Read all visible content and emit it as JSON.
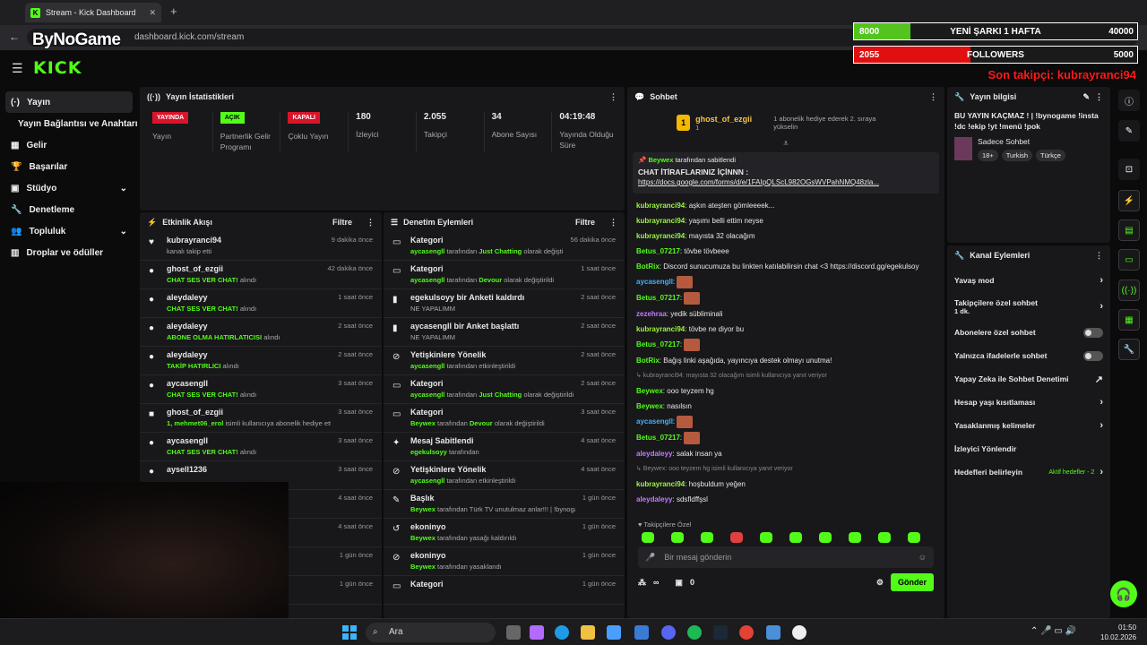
{
  "browser": {
    "tab_title": "Stream - Kick Dashboard",
    "url": "dashboard.kick.com/stream",
    "overlay_brand": "ByNoGame"
  },
  "overlay": {
    "song_left": "8000",
    "song_title": "YENİ ŞARKI 1 HAFTA",
    "song_right": "40000",
    "song_progress": 0.2,
    "fol_left": "2055",
    "fol_title": "FOLLOWERS",
    "fol_right": "5000",
    "fol_progress": 0.41,
    "last_follow": "Son takipçi: kubrayranci94"
  },
  "header": {
    "logo": "KICK"
  },
  "sidebar": [
    {
      "label": "Yayın",
      "active": true
    },
    {
      "label": "Yayın Bağlantısı ve Anahtarı"
    },
    {
      "label": "Gelir"
    },
    {
      "label": "Başarılar"
    },
    {
      "label": "Stüdyo",
      "chev": true
    },
    {
      "label": "Denetleme"
    },
    {
      "label": "Topluluk",
      "chev": true
    },
    {
      "label": "Droplar ve ödüller"
    }
  ],
  "stats": {
    "title": "Yayın İstatistikleri",
    "items": [
      {
        "badge": "YAYINDA",
        "badge_color": "red",
        "label": "Yayın"
      },
      {
        "badge": "AÇIK",
        "badge_color": "green",
        "label": "Partnerlik Gelir Programı"
      },
      {
        "badge": "KAPALI",
        "badge_color": "red",
        "label": "Çoklu Yayın"
      },
      {
        "num": "180",
        "label": "İzleyici"
      },
      {
        "num": "2.055",
        "label": "Takipçi"
      },
      {
        "num": "34",
        "label": "Abone Sayısı"
      },
      {
        "num": "04:19:48",
        "label": "Yayında Olduğu Süre"
      }
    ]
  },
  "activity": {
    "title": "Etkinlik Akışı",
    "filter": "Filtre",
    "rows": [
      {
        "icon": "♥",
        "user": "kubrayranci94",
        "detail": "kanalı takip etti",
        "hl": "",
        "time": "9 dakika önce"
      },
      {
        "icon": "●",
        "user": "ghost_of_ezgii",
        "hl": "CHAT SES VER CHAT!",
        "detail": " alındı",
        "time": "42 dakika önce"
      },
      {
        "icon": "●",
        "user": "aleydaleyy",
        "hl": "CHAT SES VER CHAT!",
        "detail": " alındı",
        "time": "1 saat önce"
      },
      {
        "icon": "●",
        "user": "aleydaleyy",
        "hl": "ABONE OLMA HATIRLATICISI",
        "detail": " alındı",
        "time": "2 saat önce"
      },
      {
        "icon": "●",
        "user": "aleydaleyy",
        "hl": "TAKİP HATIRLICI",
        "detail": " alındı",
        "time": "2 saat önce"
      },
      {
        "icon": "●",
        "user": "aycasengll",
        "hl": "CHAT SES VER CHAT!",
        "detail": " alındı",
        "time": "3 saat önce"
      },
      {
        "icon": "■",
        "user": "ghost_of_ezgii",
        "hl": "1, mehmet06_erol",
        "detail": " isimli kullanıcıya abonelik hediye etti.",
        "time": "3 saat önce"
      },
      {
        "icon": "●",
        "user": "aycasengll",
        "hl": "CHAT SES VER CHAT!",
        "detail": " alındı",
        "time": "3 saat önce"
      },
      {
        "icon": "●",
        "user": "aysell1236",
        "hl": "",
        "detail": "",
        "time": "3 saat önce"
      },
      {
        "icon": "",
        "user": "",
        "hl": "",
        "detail": "",
        "time": "4 saat önce"
      },
      {
        "icon": "",
        "user": "",
        "hl": "",
        "detail": "",
        "time": "4 saat önce"
      },
      {
        "icon": "",
        "user": "",
        "hl": "",
        "detail": "",
        "time": "1 gün önce"
      },
      {
        "icon": "",
        "user": "",
        "hl": "",
        "detail": "",
        "time": "1 gün önce"
      }
    ]
  },
  "moderation": {
    "title": "Denetim Eylemleri",
    "filter": "Filtre",
    "rows": [
      {
        "icon": "▭",
        "title": "Kategori",
        "hl": "aycasengll",
        "detail": " tarafından ",
        "hl2": "Just Chatting",
        "detail2": " olarak değiştirildi",
        "time": "56 dakika önce"
      },
      {
        "icon": "▭",
        "title": "Kategori",
        "hl": "aycasengll",
        "detail": " tarafından ",
        "hl2": "Devour",
        "detail2": " olarak değiştirildi",
        "time": "1 saat önce"
      },
      {
        "icon": "▮",
        "title": "egekulsoyy bir Anketi kaldırdı",
        "hl": "",
        "detail": "NE YAPALIMM",
        "hl2": "",
        "detail2": "",
        "time": "2 saat önce"
      },
      {
        "icon": "▮",
        "title": "aycasengll bir Anket başlattı",
        "hl": "",
        "detail": "NE YAPALIMM",
        "hl2": "",
        "detail2": "",
        "time": "2 saat önce"
      },
      {
        "icon": "⊘",
        "title": "Yetişkinlere Yönelik",
        "hl": "aycasengll",
        "detail": " tarafından etkinleştirildi",
        "hl2": "",
        "detail2": "",
        "time": "2 saat önce"
      },
      {
        "icon": "▭",
        "title": "Kategori",
        "hl": "aycasengll",
        "detail": " tarafından ",
        "hl2": "Just Chatting",
        "detail2": " olarak değiştirildi",
        "time": "2 saat önce"
      },
      {
        "icon": "▭",
        "title": "Kategori",
        "hl": "Beywex",
        "detail": " tarafından ",
        "hl2": "Devour",
        "detail2": " olarak değiştirildi",
        "time": "3 saat önce"
      },
      {
        "icon": "✦",
        "title": "Mesaj Sabitlendi",
        "hl": "egekulsoyy",
        "detail": " tarafından",
        "hl2": "",
        "detail2": "",
        "time": "4 saat önce"
      },
      {
        "icon": "⊘",
        "title": "Yetişkinlere Yönelik",
        "hl": "aycasengll",
        "detail": " tarafından etkinleştirildi",
        "hl2": "",
        "detail2": "",
        "time": "4 saat önce"
      },
      {
        "icon": "✎",
        "title": "Başlık",
        "hl": "Beywex",
        "detail": " tarafından Türk TV unutulmaz anlar!!! | !bynogame !insta !dc !ekip !yt !menü !pok",
        "hl2": "",
        "detail2": "",
        "time": "1 gün önce"
      },
      {
        "icon": "↺",
        "title": "ekoninyo",
        "hl": "Beywex",
        "detail": " tarafından yasağı kaldırıldı",
        "hl2": "",
        "detail2": "",
        "time": "1 gün önce"
      },
      {
        "icon": "⊘",
        "title": "ekoninyo",
        "hl": "Beywex",
        "detail": " tarafından yasaklandı",
        "hl2": "",
        "detail2": "",
        "time": "1 gün önce"
      },
      {
        "icon": "▭",
        "title": "Kategori",
        "hl": "",
        "detail": "",
        "hl2": "",
        "detail2": "",
        "time": "1 gün önce"
      }
    ]
  },
  "chat": {
    "title": "Sohbet",
    "top_user": "ghost_of_ezgii",
    "top_count": "1",
    "top_note": "1 abonelik hediye ederek 2. sıraya yükselin",
    "pin_by": "Beywex",
    "pin_suffix": " tarafından sabitlendi",
    "pin_text": "CHAT İTİRAFLARINIZ İÇİNNN :",
    "pin_link": "https://docs.google.com/forms/d/e/1FAIpQLScL982OGsWVPahNMQ48zla...",
    "messages": [
      {
        "u": "kubrayranci94",
        "c": "lime",
        "t": "aşkın ateşten gömleeeek..."
      },
      {
        "u": "kubrayranci94",
        "c": "lime",
        "t": "yaşımı belli ettim neyse"
      },
      {
        "u": "kubrayranci94",
        "c": "lime",
        "t": "mayısta 32 olacağım"
      },
      {
        "u": "Betus_07217",
        "c": "pink",
        "t": "tövbe tövbeee"
      },
      {
        "u": "BotRix",
        "c": "pink",
        "t": "Discord sunucumuza bu linkten katılabilirsin chat <3 https://discord.gg/egekulsoy"
      },
      {
        "u": "aycasengll",
        "c": "blue",
        "t": "",
        "emo": true
      },
      {
        "u": "Betus_07217",
        "c": "pink",
        "t": "",
        "emo": true
      },
      {
        "u": "zezehraa",
        "c": "purple",
        "t": "yedik sübliminali"
      },
      {
        "u": "kubrayranci94",
        "c": "lime",
        "t": "tövbe ne diyor bu"
      },
      {
        "u": "Betus_07217",
        "c": "pink",
        "t": "",
        "emo": true
      },
      {
        "u": "BotRix",
        "c": "pink",
        "t": "Bağış linki aşağıda, yayıncıya destek olmayı unutma!"
      },
      {
        "u": "",
        "c": "reply",
        "t": "↳ kubrayranci94: mayısta 32 olacağım isimli kullanıcıya yanıt veriyor"
      },
      {
        "u": "Beywex",
        "c": "yel",
        "t": "ooo teyzem hg"
      },
      {
        "u": "Beywex",
        "c": "yel",
        "t": "nasılsın"
      },
      {
        "u": "aycasengll",
        "c": "blue",
        "t": "",
        "emo": true
      },
      {
        "u": "Betus_07217",
        "c": "pink",
        "t": "",
        "emo": true
      },
      {
        "u": "aleydaleyy",
        "c": "purple",
        "t": "salak insan ya"
      },
      {
        "u": "",
        "c": "reply",
        "t": "↳ Beywex: ooo teyzem hg isimli kullanıcıya yanıt veriyor"
      },
      {
        "u": "kubrayranci94",
        "c": "lime",
        "t": "hoşbuldum yeğen"
      },
      {
        "u": "aleydaleyy",
        "c": "purple",
        "t": "sdsfldffşsl"
      }
    ],
    "followers_only": "Takipçilere Özel",
    "input_placeholder": "Bir mesaj gönderin",
    "points": "∞",
    "gifts": "0",
    "send": "Gönder"
  },
  "info": {
    "title": "Yayın bilgisi",
    "stream_title": "BU YAYIN KAÇMAZ ! | !bynogame !insta !dc !ekip !yt !menü !pok",
    "category": "Sadece Sohbet",
    "tags": [
      "18+",
      "Turkish",
      "Türkçe"
    ]
  },
  "channel": {
    "title": "Kanal Eylemleri",
    "rows": [
      {
        "label": "Yavaş mod",
        "kind": "arrow"
      },
      {
        "label": "Takipçilere özel sohbet",
        "sub": "1 dk.",
        "kind": "arrow"
      },
      {
        "label": "Abonelere özel sohbet",
        "kind": "toggle"
      },
      {
        "label": "Yalnızca ifadelerle sohbet",
        "kind": "toggle"
      },
      {
        "label": "Yapay Zeka ile Sohbet Denetimi",
        "kind": "ext"
      },
      {
        "label": "Hesap yaşı kısıtlaması",
        "kind": "arrow"
      },
      {
        "label": "Yasaklanmış kelimeler",
        "kind": "arrow"
      },
      {
        "label": "İzleyici Yönlendir",
        "kind": "none"
      },
      {
        "label": "Hedefleri belirleyin",
        "sub2": "Aktif hedefler - 2",
        "kind": "arrow"
      }
    ]
  },
  "taskbar": {
    "search": "Ara",
    "time": "01:50",
    "date": "10.02.2026"
  }
}
